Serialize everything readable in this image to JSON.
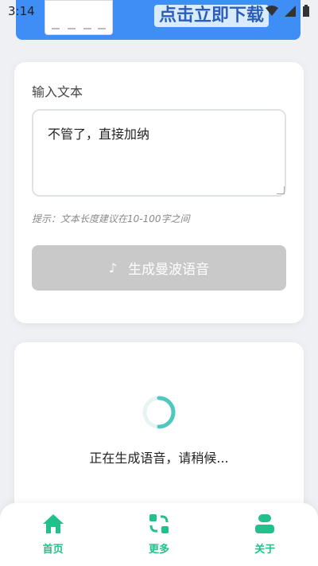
{
  "status_bar": {
    "time": "3:14"
  },
  "banner": {
    "cta": "点击立即下载"
  },
  "input": {
    "label": "输入文本",
    "value": "不管了，直接加纳",
    "hint": "提示：文本长度建议在10-100字之间"
  },
  "generate_button": {
    "label": "生成曼波语音"
  },
  "loading": {
    "text": "正在生成语音，请稍候..."
  },
  "nav": {
    "items": [
      {
        "label": "首页",
        "icon": "home-icon"
      },
      {
        "label": "更多",
        "icon": "more-icon"
      },
      {
        "label": "关于",
        "icon": "user-icon"
      }
    ]
  },
  "colors": {
    "accent": "#22c08a",
    "button_disabled": "#c9c9c9",
    "banner": "#3f8ef5",
    "spinner": "#4fc9c0"
  }
}
